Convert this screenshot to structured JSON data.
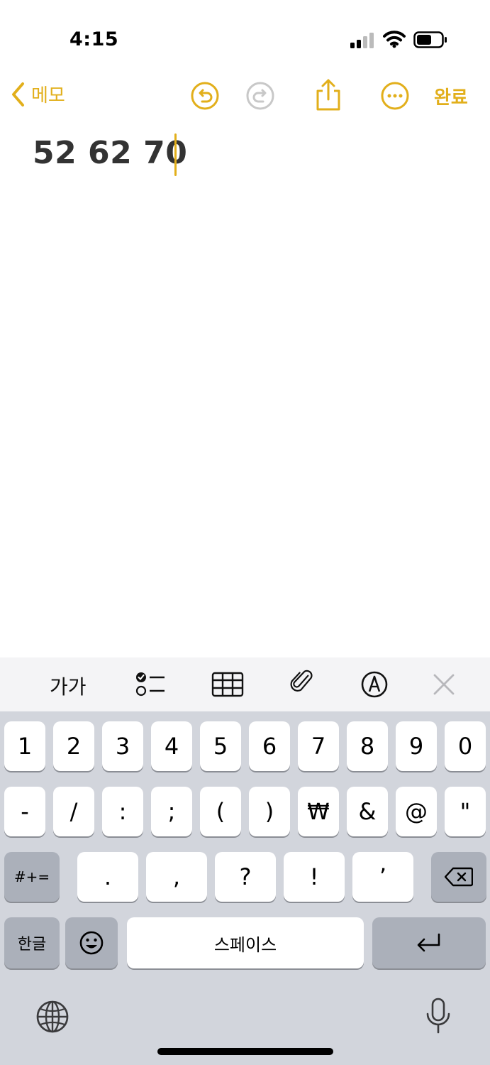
{
  "status_bar": {
    "time": "4:15"
  },
  "nav": {
    "back_label": "메모",
    "done_label": "완료"
  },
  "note": {
    "text": "52 62 70"
  },
  "toolbar": {
    "text_style_label": "가가"
  },
  "keyboard": {
    "row1": [
      "1",
      "2",
      "3",
      "4",
      "5",
      "6",
      "7",
      "8",
      "9",
      "0"
    ],
    "row2": [
      "-",
      "/",
      ":",
      ";",
      "(",
      ")",
      "₩",
      "&",
      "@",
      "\""
    ],
    "row3": [
      ".",
      ",",
      "?",
      "!",
      "’"
    ],
    "symbols_label": "#+=",
    "language_label": "한글",
    "space_label": "스페이스"
  },
  "colors": {
    "accent": "#E2AF1B",
    "keyboard_bg": "#d2d5dc",
    "toolbar_bg": "#f4f4f6"
  },
  "icons": [
    "chevron-left-icon",
    "undo-icon",
    "redo-icon",
    "share-icon",
    "more-icon",
    "checklist-icon",
    "table-icon",
    "attachment-icon",
    "markup-icon",
    "close-icon",
    "delete-icon",
    "return-icon",
    "emoji-icon",
    "globe-icon",
    "microphone-icon"
  ]
}
